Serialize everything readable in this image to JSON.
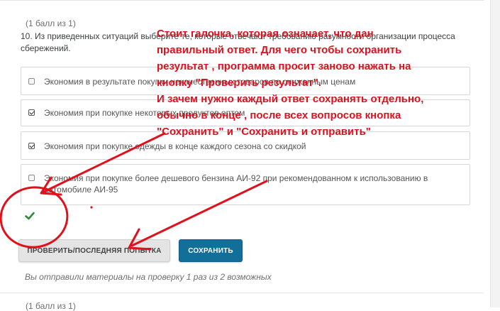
{
  "question_block": {
    "points": "(1 балл из 1)",
    "question_text": "10. Из приведенных ситуаций выберите те, которые отвечают требованию разумности организации процесса сбережений.",
    "answers": [
      {
        "text": "Экономия в результате покупки некачественных товаров по сниженным ценам",
        "checked": false
      },
      {
        "text": "Экономия при покупке некоторых продуктов оптом",
        "checked": true
      },
      {
        "text": "Экономия при покупке одежды в конце каждого сезона со скидкой",
        "checked": true
      },
      {
        "text": "Экономия при покупке более дешевого бензина АИ-92 при рекомендованном к использованию в автомобиле АИ-95",
        "checked": false
      }
    ],
    "status_icon": "check-icon",
    "buttons": {
      "check_label": "ПРОВЕРИТЬ/ПОСЛЕДНЯЯ ПОПЫТКА",
      "save_label": "СОХРАНИТЬ"
    },
    "attempts_text": "Вы отправили материалы на проверку 1 раз из 2 возможных"
  },
  "next_question": {
    "points": "(1 балл из 1)"
  },
  "annotation": {
    "text": "Стоит галочка, которая означает, что дан правильный ответ. Для чего чтобы сохранить результат , программа просит заново нажать на кнопку \"Проверить результат\".\nИ зачем нужно каждый ответ сохранять отдельно, обычно в конце , после всех вопросов кнопка \"Сохранить\" и \"Сохранить и отправить\"",
    "color": "#d9121f"
  },
  "colors": {
    "save_button": "#126f9a",
    "check_button": "#e4e4e4",
    "correct_check": "#2e8b3e"
  }
}
